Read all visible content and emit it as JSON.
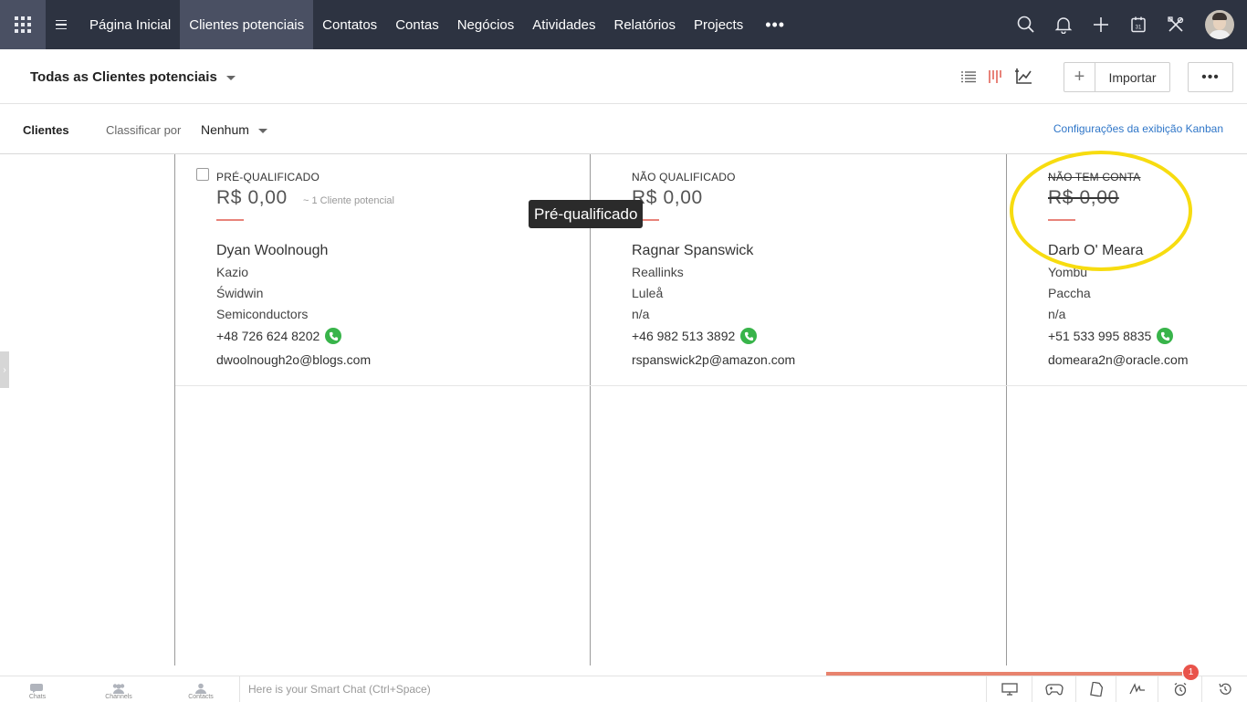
{
  "nav": {
    "items": [
      "Página Inicial",
      "Clientes potenciais",
      "Contatos",
      "Contas",
      "Negócios",
      "Atividades",
      "Relatórios",
      "Projects"
    ],
    "active_index": 1,
    "more": "•••"
  },
  "header": {
    "view_title": "Todas as Clientes potenciais",
    "import_label": "Importar",
    "plus_label": "+",
    "more_label": "•••"
  },
  "filter": {
    "module_label": "Clientes",
    "sort_label": "Classificar por",
    "sort_value": "Nenhum",
    "settings_link": "Configurações da exibição Kanban"
  },
  "columns": [
    {
      "stage": "PRÉ-QUALIFICADO",
      "amount": "R$ 0,00",
      "count": "~ 1 Cliente potencial",
      "card": {
        "name": "Dyan Woolnough",
        "company": "Kazio",
        "city": "Świdwin",
        "industry": "Semiconductors",
        "phone": "+48 726 624 8202",
        "email": "dwoolnough2o@blogs.com"
      }
    },
    {
      "stage": "NÃO QUALIFICADO",
      "amount": "R$ 0,00",
      "card": {
        "name": "Ragnar Spanswick",
        "company": "Reallinks",
        "city": "Luleå",
        "industry": "n/a",
        "phone": "+46 982 513 3892",
        "email": "rspanswick2p@amazon.com"
      }
    },
    {
      "stage": "NÃO TEM CONTA",
      "amount": "R$ 0,00",
      "card": {
        "name": "Darb O' Meara",
        "company": "Yombu",
        "city": "Paccha",
        "industry": "n/a",
        "phone": "+51 533 995 8835",
        "email": "domeara2n@oracle.com"
      }
    }
  ],
  "tooltip": "Pré-qualificado",
  "bottom": {
    "tabs": [
      "Chats",
      "Channels",
      "Contacts"
    ],
    "chat_placeholder": "Here is your Smart Chat (Ctrl+Space)",
    "badge": "1"
  },
  "colors": {
    "nav_bg": "#2d3341",
    "nav_active": "#4a5063",
    "accent_bar": "#e8837a",
    "phone_green": "#38b44a",
    "highlight": "#f7dc10",
    "link": "#2f76c8"
  }
}
